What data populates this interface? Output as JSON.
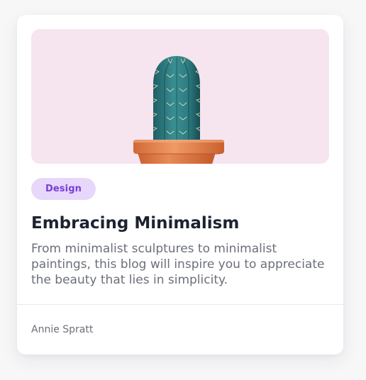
{
  "card": {
    "image": {
      "subject": "cactus-in-pot-icon",
      "background_color": "#f6e5ef"
    },
    "tag": {
      "label": "Design",
      "background_color": "#e7d7fb",
      "text_color": "#7a3fd4"
    },
    "title": "Embracing Minimalism",
    "description": "From minimalist sculptures to minimalist paintings, this blog will inspire you to appreciate the beauty that lies in simplicity.",
    "author": "Annie Spratt"
  }
}
